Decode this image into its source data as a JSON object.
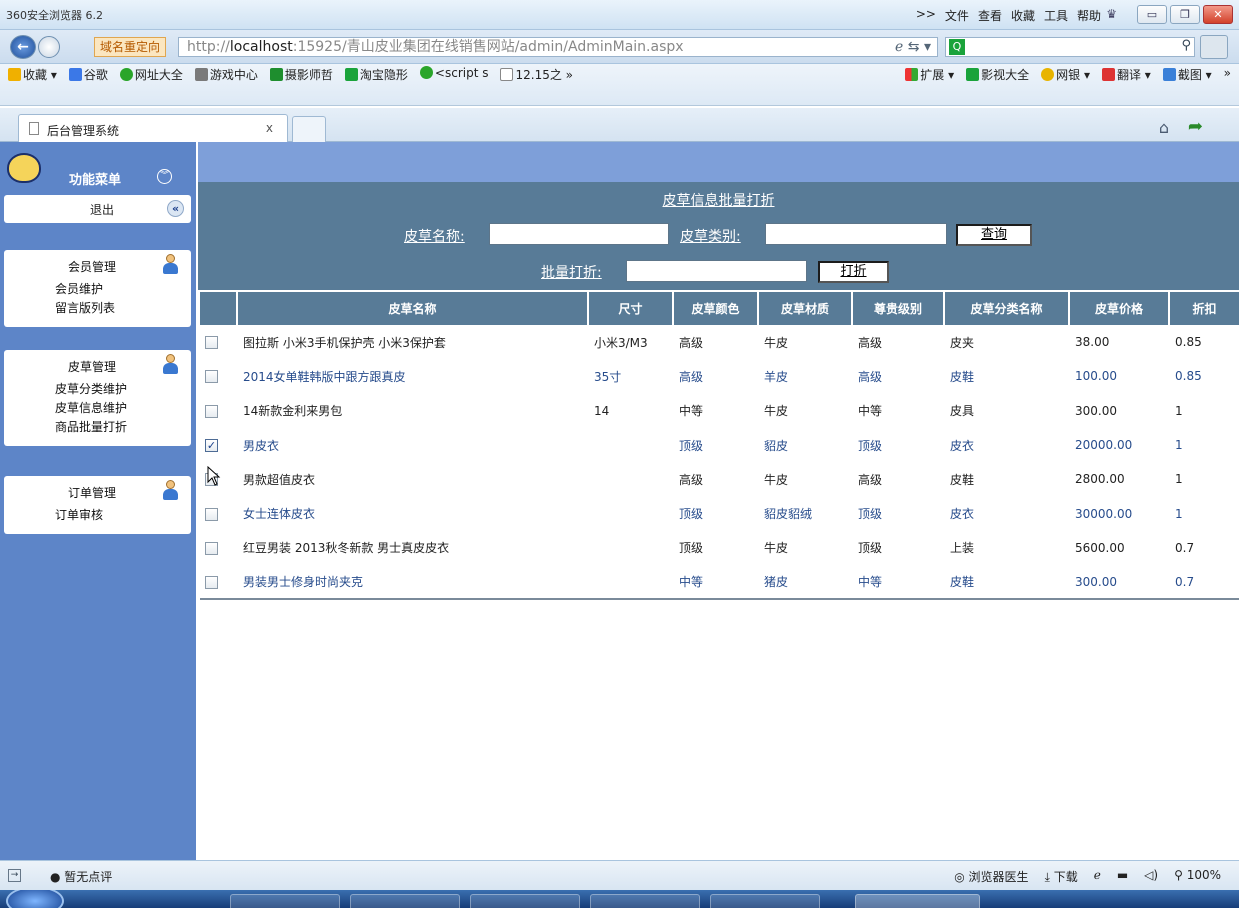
{
  "browser": {
    "app_title": "360安全浏览器 6.2",
    "menu": [
      ">>",
      "文件",
      "查看",
      "收藏",
      "工具",
      "帮助"
    ],
    "redirect_label": "域名重定向",
    "url_prefix": "http://",
    "url_host": "localhost",
    "url_rest": ":15925/青山皮业集团在线销售网站/admin/AdminMain.aspx",
    "favorites": [
      "收藏 ▾",
      "谷歌",
      "网址大全",
      "游戏中心",
      "摄影师哲",
      "淘宝隐形",
      "<script s",
      "12.15之 »"
    ],
    "favorites_right": [
      "扩展 ▾",
      "影视大全",
      "网银 ▾",
      "翻译 ▾",
      "截图 ▾",
      "»"
    ],
    "tab_label": "后台管理系统",
    "tab_close": "x"
  },
  "sidebar": {
    "menu_title": "功能菜单",
    "exit_label": "退出",
    "groups": [
      {
        "title": "会员管理",
        "items": [
          "会员维护",
          "留言版列表"
        ]
      },
      {
        "title": "皮草管理",
        "items": [
          "皮草分类维护",
          "皮草信息维护",
          "商品批量打折"
        ]
      },
      {
        "title": "订单管理",
        "items": [
          "订单审核"
        ]
      }
    ]
  },
  "form": {
    "title": "皮草信息批量打折",
    "name_label": "皮草名称:",
    "name_value": "",
    "category_label": "皮草类别:",
    "category_value": "",
    "query_button": "查询",
    "discount_label": "批量打折:",
    "discount_value": "",
    "discount_button": "打折"
  },
  "table": {
    "headers": [
      "",
      "皮草名称",
      "尺寸",
      "皮草颜色",
      "皮草材质",
      "尊贵级别",
      "皮草分类名称",
      "皮草价格",
      "折扣"
    ],
    "rows": [
      {
        "checked": false,
        "name": "图拉斯 小米3手机保护壳 小米3保护套",
        "size": "小米3/M3",
        "color": "高级",
        "material": "牛皮",
        "level": "高级",
        "category": "皮夹",
        "price": "38.00",
        "discount": "0.85"
      },
      {
        "checked": false,
        "name": "2014女单鞋韩版中跟方跟真皮",
        "size": "35寸",
        "color": "高级",
        "material": "羊皮",
        "level": "高级",
        "category": "皮鞋",
        "price": "100.00",
        "discount": "0.85"
      },
      {
        "checked": false,
        "name": "14新款金利来男包",
        "size": "14",
        "color": "中等",
        "material": "牛皮",
        "level": "中等",
        "category": "皮具",
        "price": "300.00",
        "discount": "1"
      },
      {
        "checked": true,
        "name": "男皮衣",
        "size": "",
        "color": "顶级",
        "material": "貂皮",
        "level": "顶级",
        "category": "皮衣",
        "price": "20000.00",
        "discount": "1"
      },
      {
        "checked": false,
        "name": "男款超值皮衣",
        "size": "",
        "color": "高级",
        "material": "牛皮",
        "level": "高级",
        "category": "皮鞋",
        "price": "2800.00",
        "discount": "1"
      },
      {
        "checked": false,
        "name": "女士连体皮衣",
        "size": "",
        "color": "顶级",
        "material": "貂皮貂绒",
        "level": "顶级",
        "category": "皮衣",
        "price": "30000.00",
        "discount": "1"
      },
      {
        "checked": false,
        "name": "红豆男装 2013秋冬新款 男士真皮皮衣",
        "size": "",
        "color": "顶级",
        "material": "牛皮",
        "level": "顶级",
        "category": "上装",
        "price": "5600.00",
        "discount": "0.7"
      },
      {
        "checked": false,
        "name": "男装男士修身时尚夹克",
        "size": "",
        "color": "中等",
        "material": "猪皮",
        "level": "中等",
        "category": "皮鞋",
        "price": "300.00",
        "discount": "0.7"
      }
    ]
  },
  "statusbar": {
    "left_text": "暂无点评",
    "right_items": [
      "浏览器医生",
      "下载",
      "100%"
    ]
  },
  "colors": {
    "sidebar_bg": "#5d85c8",
    "header_bg": "#587b97",
    "top_band": "#7e9fd9"
  }
}
